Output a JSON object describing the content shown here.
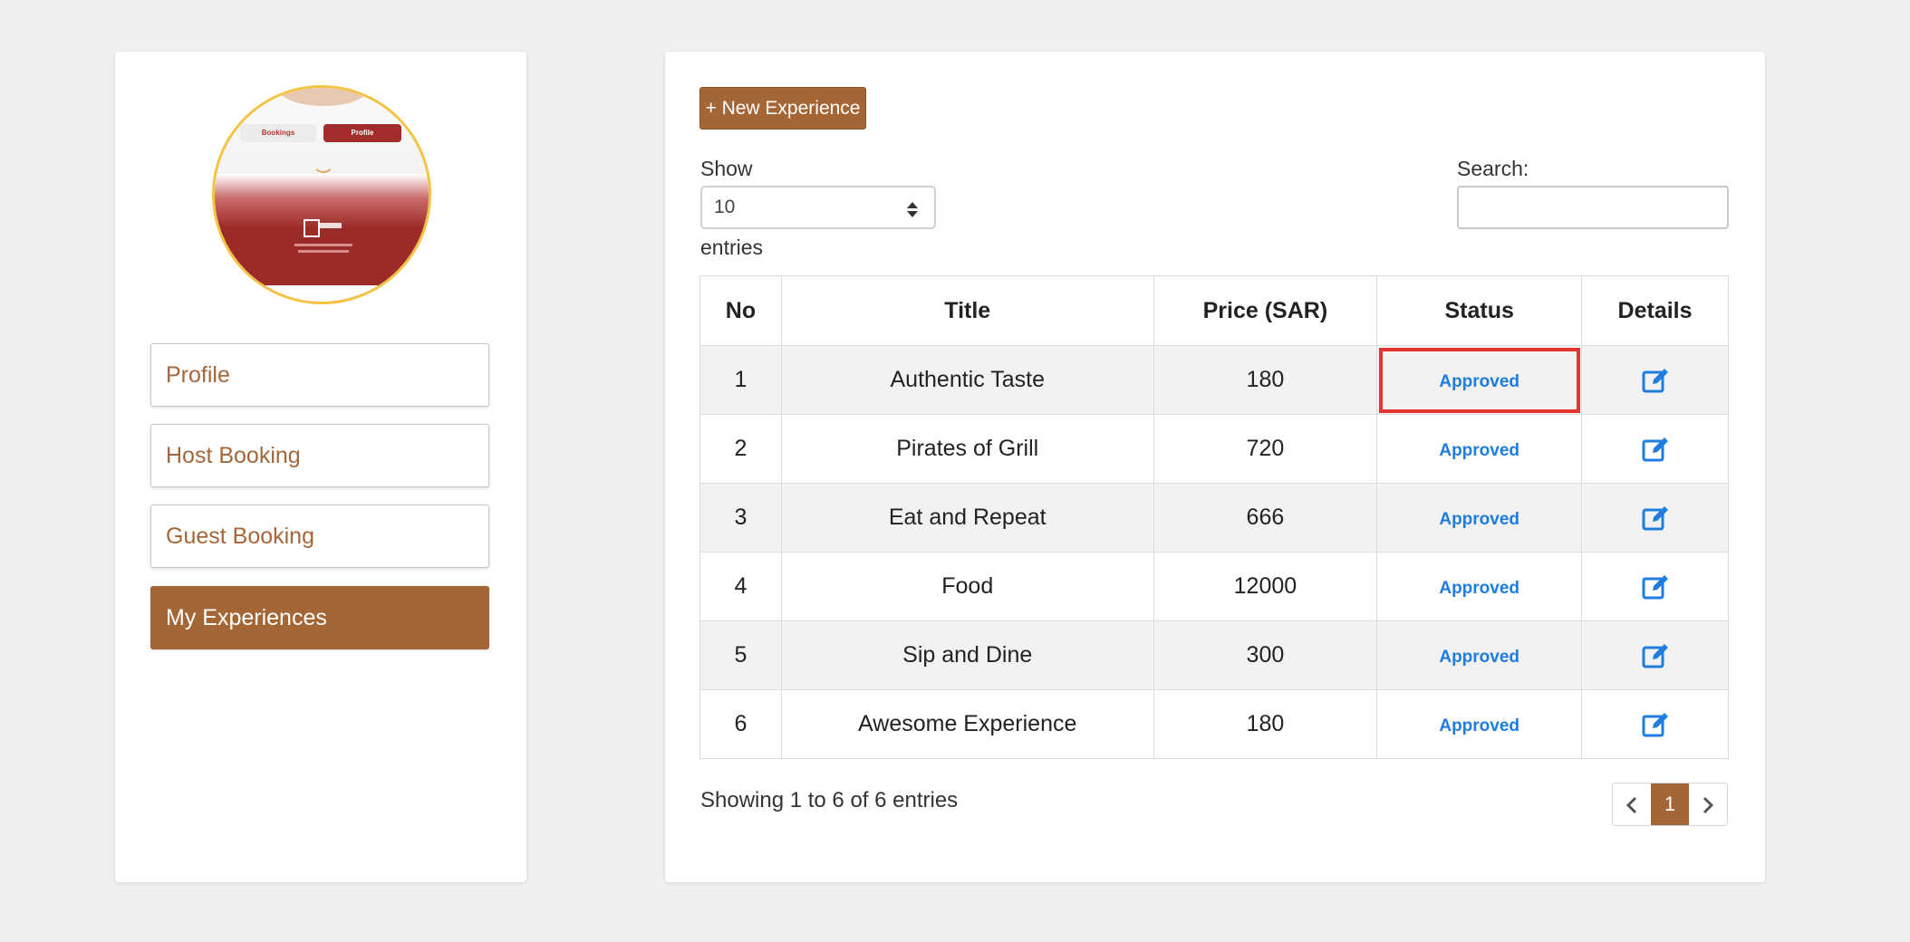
{
  "sidebar": {
    "avatar_tabs": [
      "Bookings",
      "Profile"
    ],
    "items": [
      {
        "label": "Profile",
        "active": false
      },
      {
        "label": "Host Booking",
        "active": false
      },
      {
        "label": "Guest Booking",
        "active": false
      },
      {
        "label": "My Experiences",
        "active": true
      }
    ]
  },
  "main": {
    "new_button": "+ New Experience",
    "show_label": "Show",
    "page_size": "10",
    "entries_label": "entries",
    "search_label": "Search:",
    "search_value": "",
    "columns": [
      "No",
      "Title",
      "Price (SAR)",
      "Status",
      "Details"
    ],
    "rows": [
      {
        "no": "1",
        "title": "Authentic Taste",
        "price": "180",
        "status": "Approved"
      },
      {
        "no": "2",
        "title": "Pirates of Grill",
        "price": "720",
        "status": "Approved"
      },
      {
        "no": "3",
        "title": "Eat and Repeat",
        "price": "666",
        "status": "Approved"
      },
      {
        "no": "4",
        "title": "Food",
        "price": "12000",
        "status": "Approved"
      },
      {
        "no": "5",
        "title": "Sip and Dine",
        "price": "300",
        "status": "Approved"
      },
      {
        "no": "6",
        "title": "Awesome Experience",
        "price": "180",
        "status": "Approved"
      }
    ],
    "info": "Showing 1 to 6 of 6 entries",
    "pagination": {
      "prev_icon": "chevron-left-icon",
      "current": "1",
      "next_icon": "chevron-right-icon"
    }
  },
  "colors": {
    "brand": "#a56636",
    "status_approved": "#1f7de0",
    "highlight": "#e3342f",
    "avatar_border": "#f5c242"
  }
}
